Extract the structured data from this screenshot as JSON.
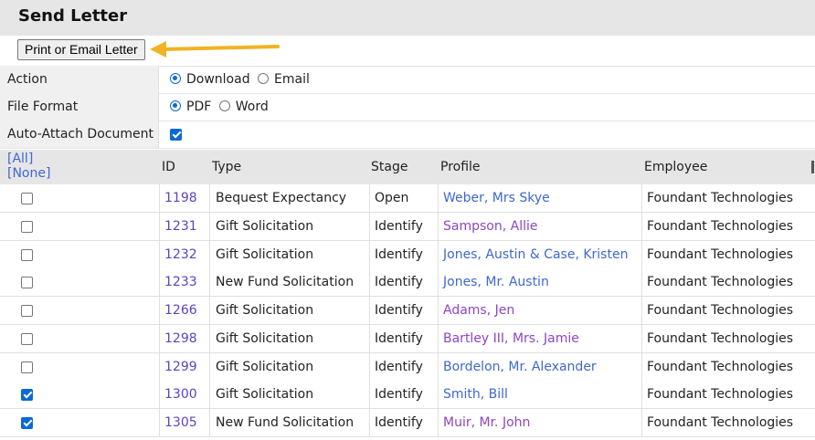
{
  "title": "Send Letter",
  "print_button": "Print or Email Letter",
  "options": {
    "action": {
      "label": "Action",
      "choices": [
        "Download",
        "Email"
      ],
      "selected": "Download"
    },
    "file_format": {
      "label": "File Format",
      "choices": [
        "PDF",
        "Word"
      ],
      "selected": "PDF"
    },
    "auto_attach": {
      "label": "Auto-Attach Document",
      "checked": true
    }
  },
  "table": {
    "select_all": "[All]",
    "select_none": "[None]",
    "columns": [
      "ID",
      "Type",
      "Stage",
      "Profile",
      "Employee"
    ],
    "rows": [
      {
        "checked": false,
        "id": "1198",
        "type": "Bequest Expectancy",
        "stage": "Open",
        "profile": "Weber, Mrs Skye",
        "profile_visited": false,
        "employee": "Foundant Technologies"
      },
      {
        "checked": false,
        "id": "1231",
        "type": "Gift Solicitation",
        "stage": "Identify",
        "profile": "Sampson, Allie",
        "profile_visited": true,
        "employee": "Foundant Technologies"
      },
      {
        "checked": false,
        "id": "1232",
        "type": "Gift Solicitation",
        "stage": "Identify",
        "profile": "Jones, Austin & Case, Kristen",
        "profile_visited": false,
        "employee": "Foundant Technologies"
      },
      {
        "checked": false,
        "id": "1233",
        "type": "New Fund Solicitation",
        "stage": "Identify",
        "profile": "Jones, Mr. Austin",
        "profile_visited": false,
        "employee": "Foundant Technologies"
      },
      {
        "checked": false,
        "id": "1266",
        "type": "Gift Solicitation",
        "stage": "Identify",
        "profile": "Adams, Jen",
        "profile_visited": true,
        "employee": "Foundant Technologies"
      },
      {
        "checked": false,
        "id": "1298",
        "type": "Gift Solicitation",
        "stage": "Identify",
        "profile": "Bartley III, Mrs. Jamie",
        "profile_visited": true,
        "employee": "Foundant Technologies"
      },
      {
        "checked": false,
        "id": "1299",
        "type": "Gift Solicitation",
        "stage": "Identify",
        "profile": "Bordelon, Mr. Alexander",
        "profile_visited": false,
        "employee": "Foundant Technologies"
      },
      {
        "checked": true,
        "id": "1300",
        "type": "Gift Solicitation",
        "stage": "Identify",
        "profile": "Smith, Bill",
        "profile_visited": false,
        "employee": "Foundant Technologies"
      },
      {
        "checked": true,
        "id": "1305",
        "type": "New Fund Solicitation",
        "stage": "Identify",
        "profile": "Muir, Mr. John",
        "profile_visited": true,
        "employee": "Foundant Technologies"
      }
    ]
  },
  "colors": {
    "link": "#3f67cf",
    "visited_link": "#8e45c8",
    "arrow": "#f0b323",
    "header_bg": "#e6e6e6"
  },
  "icons": {
    "annotation": "arrow-left-icon"
  }
}
